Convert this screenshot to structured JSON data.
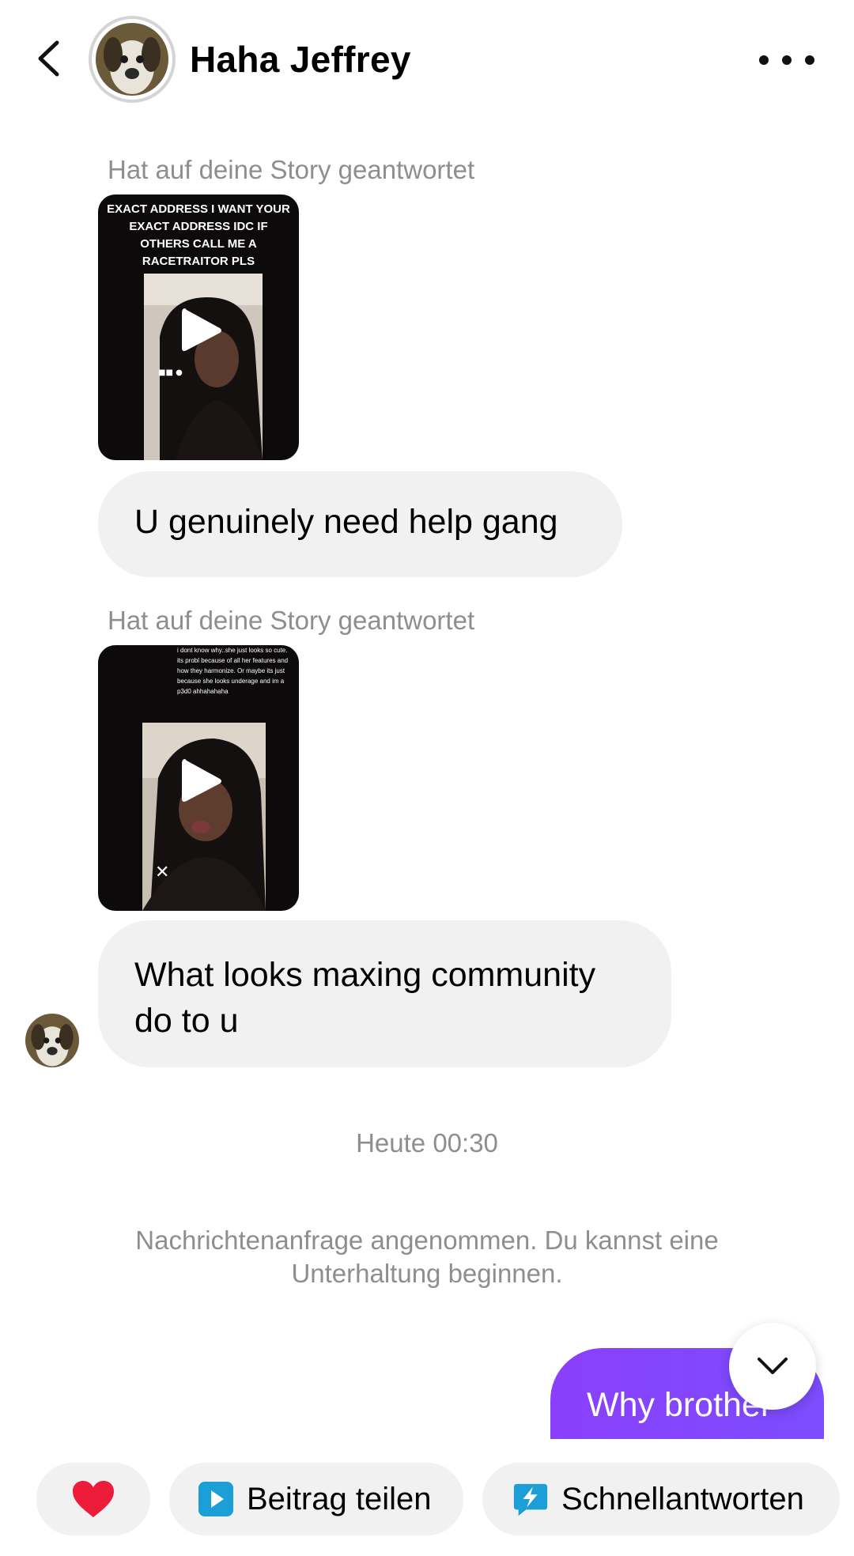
{
  "header": {
    "back_icon": "chevron-left-icon",
    "contact_name": "Haha Jeffrey",
    "more_icon": "more-horizontal-icon"
  },
  "messages": [
    {
      "type": "story_reply",
      "label": "Hat auf deine Story geantwortet",
      "story_text": "EXACT ADDRESS I WANT YOUR EXACT ADDRESS IDC IF OTHERS CALL ME A RACETRAITOR PLS",
      "reply": "U genuinely need help gang"
    },
    {
      "type": "story_reply",
      "label": "Hat auf deine Story geantwortet",
      "story_text": "i dont know why..she just looks so cute. its probl because of all her features and how they harmonize. Or maybe its just because she looks underage and im a p3d0 ahhahahaha",
      "reply": "What looks maxing community do to u"
    }
  ],
  "timestamp": "Heute 00:30",
  "system_note": "Nachrichtenanfrage angenommen. Du kannst eine Unterhaltung beginnen.",
  "outgoing": {
    "text": "Why brother"
  },
  "scroll_down_icon": "chevron-down-icon",
  "quick_actions": {
    "heart_icon": "heart-icon",
    "share_label": "Beitrag teilen",
    "share_icon": "play-square-icon",
    "quick_replies_label": "Schnellantworten",
    "quick_replies_icon": "lightning-bubble-icon"
  },
  "colors": {
    "outgoing_bubble": "#7c4dff",
    "incoming_bubble": "#f1f1f1",
    "muted_text": "#8e8e8e",
    "heart": "#ed1c3a",
    "share_icon": "#1c9fd6"
  }
}
